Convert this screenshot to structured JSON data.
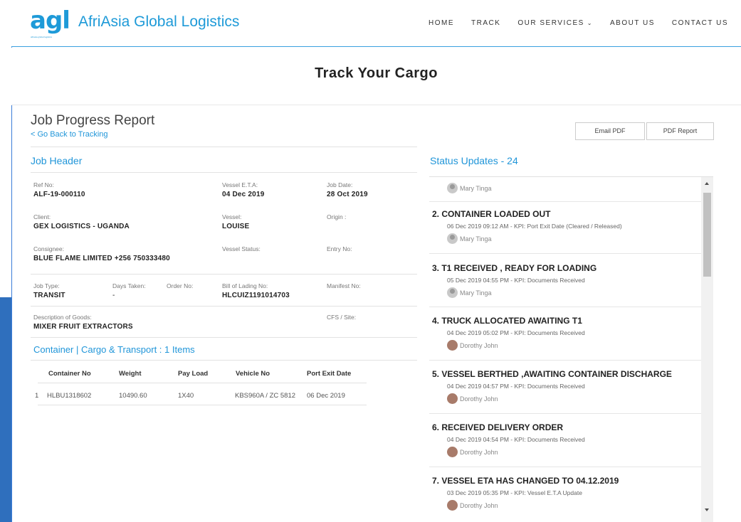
{
  "brand": {
    "mark": "agl",
    "name": "AfriAsia Global Logistics",
    "tagline": "afriasia global logistics",
    "color": "#1e9ad8"
  },
  "nav": {
    "items": [
      "HOME",
      "TRACK",
      "OUR SERVICES",
      "ABOUT US",
      "CONTACT US"
    ]
  },
  "page_title": "Track Your Cargo",
  "report": {
    "title": "Job Progress Report",
    "back_link": "< Go Back to Tracking",
    "email_pdf": "Email PDF",
    "pdf_report": "PDF Report"
  },
  "job_header": {
    "title": "Job Header",
    "ref_no": {
      "label": "Ref No:",
      "value": "ALF-19-000110"
    },
    "vessel_eta": {
      "label": "Vessel E.T.A:",
      "value": "04 Dec 2019"
    },
    "job_date": {
      "label": "Job Date:",
      "value": "28 Oct 2019"
    },
    "client": {
      "label": "Client:",
      "value": "GEX LOGISTICS - UGANDA"
    },
    "vessel": {
      "label": "Vessel:",
      "value": "LOUISE"
    },
    "origin": {
      "label": "Origin :",
      "value": ""
    },
    "consignee": {
      "label": "Consignee:",
      "value": "BLUE FLAME LIMITED +256 750333480"
    },
    "vessel_status": {
      "label": "Vessel Status:",
      "value": ""
    },
    "entry_no": {
      "label": "Entry No:",
      "value": ""
    },
    "job_type": {
      "label": "Job Type:",
      "value": "TRANSIT"
    },
    "days_taken": {
      "label": "Days Taken:",
      "value": "-"
    },
    "order_no": {
      "label": "Order No:",
      "value": ""
    },
    "bill_of_lading": {
      "label": "Bill of Lading No:",
      "value": "HLCUIZ1191014703"
    },
    "manifest_no": {
      "label": "Manifest No:",
      "value": ""
    },
    "description": {
      "label": "Description of Goods:",
      "value": "MIXER FRUIT EXTRACTORS"
    },
    "cfs_site": {
      "label": "CFS / Site:",
      "value": ""
    }
  },
  "cargo": {
    "title": "Container | Cargo & Transport : 1 Items",
    "headers": [
      "Container No",
      "Weight",
      "Pay Load",
      "Vehicle No",
      "Port Exit Date"
    ],
    "rows": [
      {
        "index": "1",
        "container": "HLBU1318602",
        "weight": "10490.60",
        "payload": "1X40",
        "vehicle": "KBS960A / ZC 5812",
        "exit_date": "06 Dec 2019"
      }
    ]
  },
  "status": {
    "title": "Status Updates - 24",
    "first_user": "Mary Tinga",
    "items": [
      {
        "title": "2.  CONTAINER LOADED OUT",
        "meta": "06 Dec 2019 09:12 AM  - KPI: Port Exit Date (Cleared / Released)",
        "user": "Mary Tinga",
        "avatar": "grey"
      },
      {
        "title": "3.  T1 RECEIVED , READY FOR LOADING",
        "meta": "05 Dec 2019 04:55 PM  - KPI: Documents Received",
        "user": "Mary Tinga",
        "avatar": "grey"
      },
      {
        "title": "4.  TRUCK ALLOCATED AWAITING T1",
        "meta": "04 Dec 2019 05:02 PM  - KPI: Documents Received",
        "user": "Dorothy John",
        "avatar": "photo"
      },
      {
        "title": "5.  VESSEL BERTHED ,AWAITING CONTAINER DISCHARGE",
        "meta": "04 Dec 2019 04:57 PM  - KPI: Documents Received",
        "user": "Dorothy John",
        "avatar": "photo"
      },
      {
        "title": "6.  RECEIVED DELIVERY ORDER",
        "meta": "04 Dec 2019 04:54 PM  - KPI: Documents Received",
        "user": "Dorothy John",
        "avatar": "photo"
      },
      {
        "title": "7.  VESSEL ETA HAS CHANGED TO 04.12.2019",
        "meta": "03 Dec 2019 05:35 PM  - KPI: Vessel E.T.A Update",
        "user": "Dorothy John",
        "avatar": "photo"
      }
    ]
  }
}
